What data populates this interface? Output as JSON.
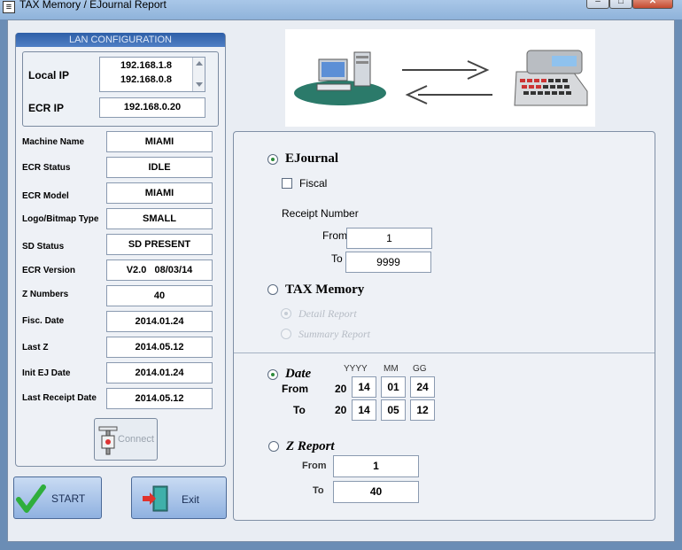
{
  "window": {
    "title": "TAX Memory / EJournal Report",
    "app_icon_glyph": "≡",
    "minimize_glyph": "–",
    "maximize_glyph": "□",
    "close_glyph": "✕"
  },
  "lan": {
    "header": "LAN CONFIGURATION",
    "local_ip_label": "Local IP",
    "local_ips": [
      "192.168.1.8",
      "192.168.0.8"
    ],
    "ecr_ip_label": "ECR IP",
    "ecr_ip": "192.168.0.20"
  },
  "info": [
    {
      "label": "Machine Name",
      "value": "MIAMI"
    },
    {
      "label": "ECR Status",
      "value": "IDLE"
    },
    {
      "label": "ECR Model",
      "value": "MIAMI"
    },
    {
      "label": "Logo/Bitmap Type",
      "value": "SMALL"
    },
    {
      "label": "SD Status",
      "value": "SD PRESENT"
    },
    {
      "label": "ECR Version",
      "value": "V2.0   08/03/14"
    },
    {
      "label": "Z Numbers",
      "value": "40"
    },
    {
      "label": "Fisc. Date",
      "value": "2014.01.24"
    },
    {
      "label": "Last Z",
      "value": "2014.05.12"
    },
    {
      "label": "Init EJ Date",
      "value": "2014.01.24"
    },
    {
      "label": "Last Receipt Date",
      "value": "2014.05.12"
    }
  ],
  "connect_label": "Connect",
  "start_label": "START",
  "exit_label": "Exit",
  "ejournal": {
    "label": "EJournal",
    "selected": true,
    "fiscal_label": "Fiscal",
    "fiscal_checked": false,
    "receipt_number_label": "Receipt Number",
    "from_label": "From",
    "from_value": "1",
    "to_label": "To",
    "to_value": "9999"
  },
  "tax_memory": {
    "label": "TAX Memory",
    "selected": false,
    "detail_label": "Detail Report",
    "summary_label": "Summary Report"
  },
  "date": {
    "label": "Date",
    "selected": true,
    "yyyy_label": "YYYY",
    "mm_label": "MM",
    "gg_label": "GG",
    "from_label": "From",
    "to_label": "To",
    "century": "20",
    "from": {
      "yy": "14",
      "mm": "01",
      "gg": "24"
    },
    "to": {
      "yy": "14",
      "mm": "05",
      "gg": "12"
    }
  },
  "z_report": {
    "label": "Z Report",
    "selected": false,
    "from_label": "From",
    "from_value": "1",
    "to_label": "To",
    "to_value": "40"
  }
}
